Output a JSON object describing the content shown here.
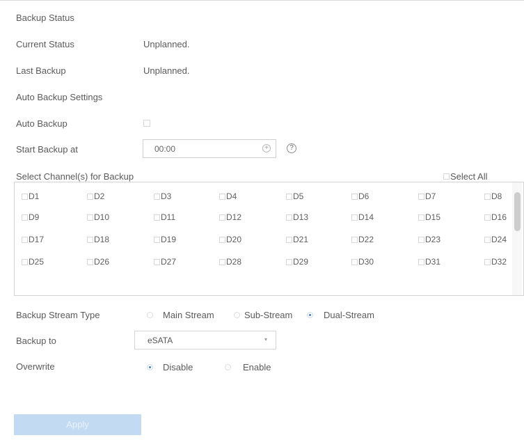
{
  "backup_status": {
    "heading": "Backup Status",
    "current_status_label": "Current Status",
    "current_status_value": "Unplanned.",
    "last_backup_label": "Last Backup",
    "last_backup_value": "Unplanned."
  },
  "auto_backup_settings": {
    "heading": "Auto Backup Settings",
    "auto_backup_label": "Auto Backup",
    "auto_backup_checked": false,
    "start_label": "Start Backup at",
    "start_time": "00:00",
    "time_icon": "plus-circle-icon",
    "help_icon": "question-circle-icon",
    "help_glyph": "?",
    "time_glyph": "+"
  },
  "channels": {
    "label": "Select Channel(s) for Backup",
    "select_all_label": "Select All",
    "items": [
      "D1",
      "D2",
      "D3",
      "D4",
      "D5",
      "D6",
      "D7",
      "D8",
      "D9",
      "D10",
      "D11",
      "D12",
      "D13",
      "D14",
      "D15",
      "D16",
      "D17",
      "D18",
      "D19",
      "D20",
      "D21",
      "D22",
      "D23",
      "D24",
      "D25",
      "D26",
      "D27",
      "D28",
      "D29",
      "D30",
      "D31",
      "D32"
    ]
  },
  "stream_type": {
    "label": "Backup Stream Type",
    "options": [
      "Main Stream",
      "Sub-Stream",
      "Dual-Stream"
    ],
    "selected": "Dual-Stream"
  },
  "backup_to": {
    "label": "Backup to",
    "value": "eSATA",
    "arrow_glyph": "▾"
  },
  "overwrite": {
    "label": "Overwrite",
    "options": [
      "Disable",
      "Enable"
    ],
    "selected": "Disable"
  },
  "apply": {
    "label": "Apply"
  },
  "colors": {
    "accent": "#3d7fd4",
    "apply_button_bg": "#c2daf2",
    "text": "#5a5a5a",
    "border": "#d3d3d3"
  }
}
